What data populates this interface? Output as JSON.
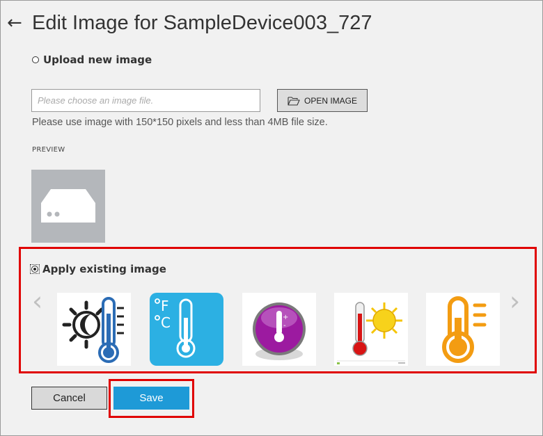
{
  "header": {
    "back_icon": "arrow-left-icon",
    "title": "Edit Image for SampleDevice003_727"
  },
  "upload": {
    "radio_label": "Upload new image",
    "file_placeholder": "Please choose an image file.",
    "open_button_label": "OPEN IMAGE",
    "open_button_icon": "folder-open-icon",
    "hint": "Please use image with 150*150 pixels and less than 4MB file size.",
    "preview_label": "PREVIEW",
    "preview_icon": "server-box-icon"
  },
  "existing": {
    "radio_label": "Apply existing image",
    "selected": true,
    "prev_arrow": "‹",
    "next_arrow": "›",
    "thumbnails": [
      "sun-thermometer-icon",
      "fahrenheit-celsius-thermometer-icon",
      "purple-thermometer-button-icon",
      "sun-red-thermometer-icon",
      "orange-thermometer-icon"
    ],
    "thumb4_caption": "(small text)"
  },
  "actions": {
    "cancel_label": "Cancel",
    "save_label": "Save"
  },
  "colors": {
    "highlight": "#e00000",
    "primary": "#1e9ad7",
    "background": "#f1f1f1"
  }
}
